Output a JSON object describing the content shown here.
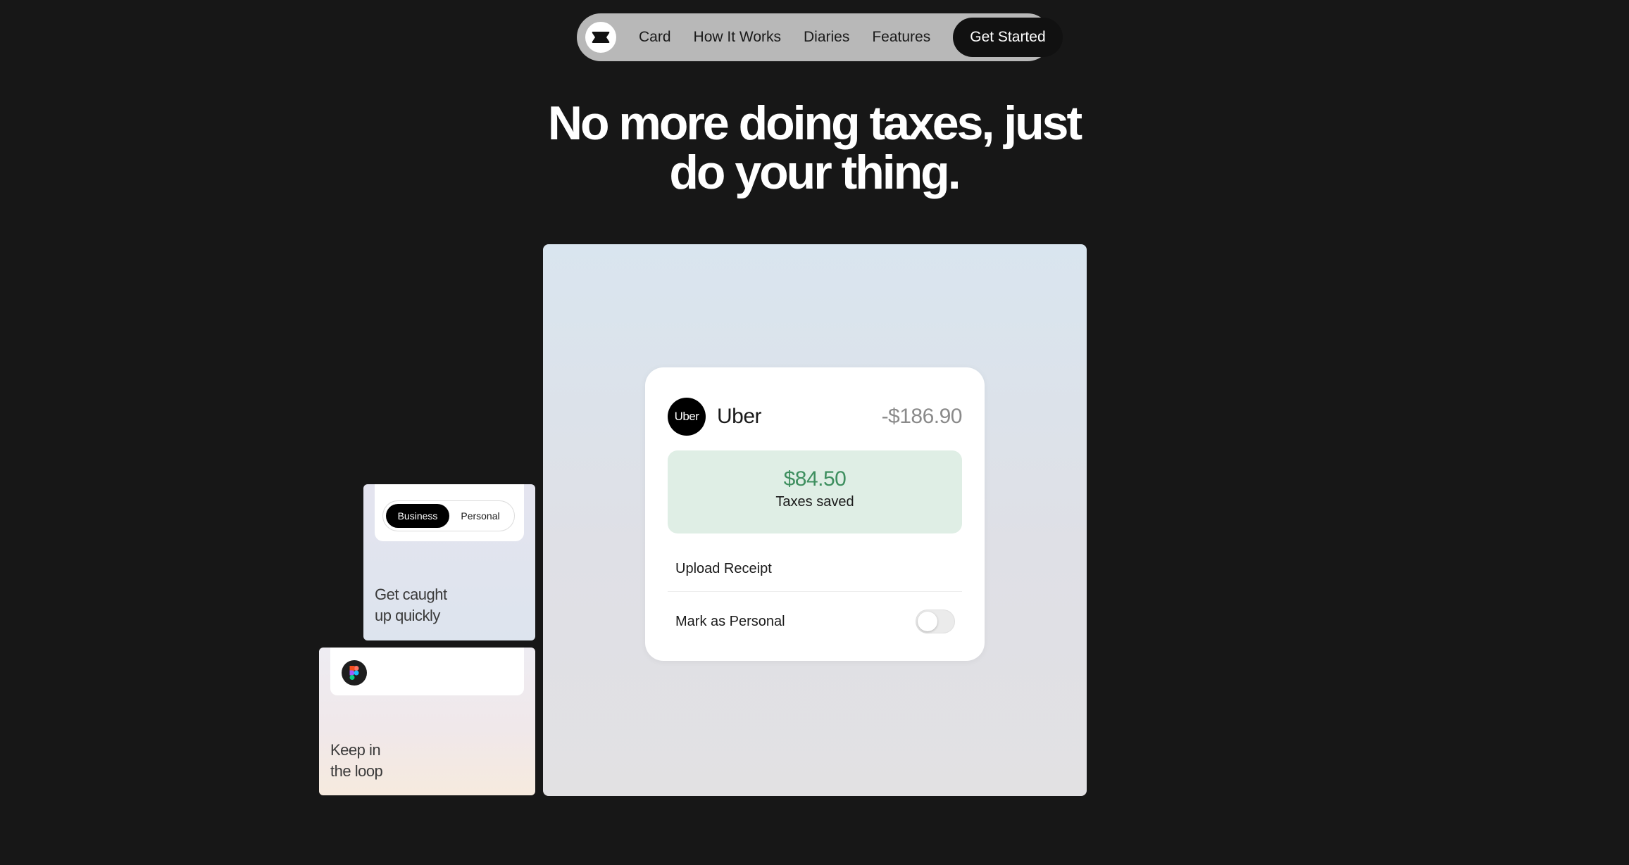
{
  "nav": {
    "links": [
      "Card",
      "How It Works",
      "Diaries",
      "Features"
    ],
    "cta_label": "Get Started"
  },
  "hero": {
    "title_line1": "No more doing taxes, just",
    "title_line2": "do your thing."
  },
  "transaction": {
    "merchant_logo_text": "Uber",
    "merchant_name": "Uber",
    "amount": "-$186.90",
    "savings_value": "$84.50",
    "savings_label": "Taxes saved",
    "upload_label": "Upload Receipt",
    "personal_label": "Mark as Personal",
    "personal_toggle_on": false
  },
  "cards": {
    "caught_up": {
      "segment_options": [
        "Business",
        "Personal"
      ],
      "selected": "Business",
      "caption_line1": "Get caught",
      "caption_line2": "up quickly"
    },
    "loop": {
      "icon": "figma-icon",
      "caption_line1": "Keep in",
      "caption_line2": "the loop"
    }
  },
  "colors": {
    "page_background": "#171717",
    "nav_background": "#b8b8b8",
    "cta_background": "#111111",
    "savings_green": "#3e8f5f",
    "savings_background": "#dfeee5"
  }
}
